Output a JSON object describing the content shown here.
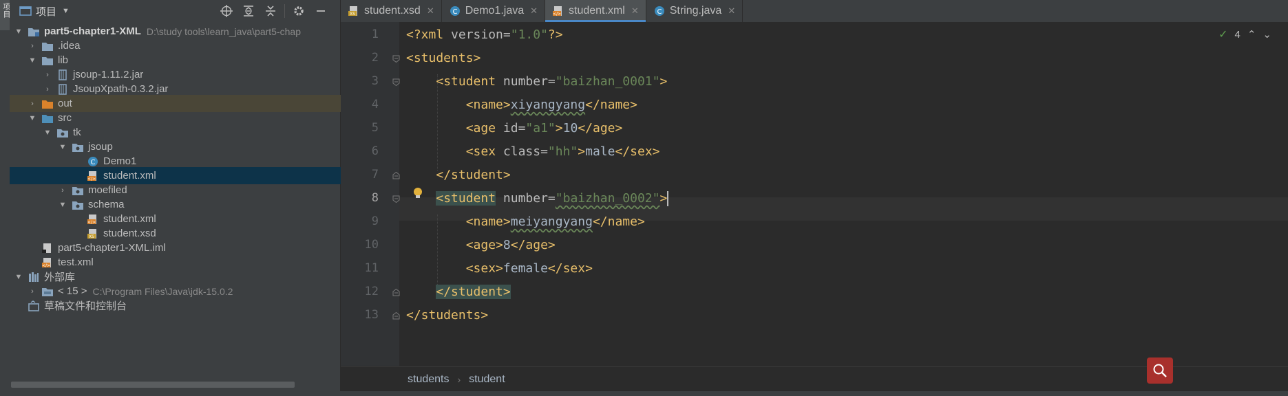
{
  "sidebar_strip": {
    "label": "项目"
  },
  "project_panel": {
    "title": "项目",
    "tree": [
      {
        "label": "part5-chapter1-XML",
        "path": "D:\\study tools\\learn_java\\part5-chap",
        "icon": "module-folder-icon",
        "depth": 0,
        "arrow": "down"
      },
      {
        "label": ".idea",
        "icon": "folder-icon",
        "depth": 1,
        "arrow": "right"
      },
      {
        "label": "lib",
        "icon": "folder-icon",
        "depth": 1,
        "arrow": "down"
      },
      {
        "label": "jsoup-1.11.2.jar",
        "icon": "jar-icon",
        "depth": 2,
        "arrow": "right"
      },
      {
        "label": "JsoupXpath-0.3.2.jar",
        "icon": "jar-icon",
        "depth": 2,
        "arrow": "right"
      },
      {
        "label": "out",
        "icon": "orange-folder-icon",
        "depth": 1,
        "arrow": "right"
      },
      {
        "label": "src",
        "icon": "source-folder-icon",
        "depth": 1,
        "arrow": "down"
      },
      {
        "label": "tk",
        "icon": "package-icon",
        "depth": 2,
        "arrow": "down"
      },
      {
        "label": "jsoup",
        "icon": "package-icon",
        "depth": 3,
        "arrow": "down"
      },
      {
        "label": "Demo1",
        "icon": "java-class-icon",
        "depth": 4,
        "arrow": ""
      },
      {
        "label": "student.xml",
        "icon": "xml-file-icon",
        "depth": 4,
        "arrow": ""
      },
      {
        "label": "moefiled",
        "icon": "package-icon",
        "depth": 3,
        "arrow": "right"
      },
      {
        "label": "schema",
        "icon": "package-icon",
        "depth": 3,
        "arrow": "down"
      },
      {
        "label": "student.xml",
        "icon": "xml-file-icon",
        "depth": 4,
        "arrow": ""
      },
      {
        "label": "student.xsd",
        "icon": "xsd-file-icon",
        "depth": 4,
        "arrow": ""
      },
      {
        "label": "part5-chapter1-XML.iml",
        "icon": "iml-file-icon",
        "depth": 1,
        "arrow": ""
      },
      {
        "label": "test.xml",
        "icon": "xml-file-icon",
        "depth": 1,
        "arrow": ""
      },
      {
        "label": "外部库",
        "icon": "library-icon",
        "depth": 0,
        "arrow": "down"
      },
      {
        "label": "< 15 >",
        "path": "C:\\Program Files\\Java\\jdk-15.0.2",
        "icon": "jdk-folder-icon",
        "depth": 1,
        "arrow": "right"
      },
      {
        "label": "草稿文件和控制台",
        "icon": "scratches-icon",
        "depth": 0,
        "arrow": ""
      }
    ]
  },
  "tabs": [
    {
      "label": "student.xsd",
      "icon": "xsd-file-icon",
      "active": false
    },
    {
      "label": "Demo1.java",
      "icon": "java-class-icon",
      "active": false
    },
    {
      "label": "student.xml",
      "icon": "xml-file-icon",
      "active": true
    },
    {
      "label": "String.java",
      "icon": "java-class-icon",
      "active": false
    }
  ],
  "editor": {
    "line_numbers": [
      "1",
      "2",
      "3",
      "4",
      "5",
      "6",
      "7",
      "8",
      "9",
      "10",
      "11",
      "12",
      "13"
    ],
    "current_line": "8",
    "inspection_count": "4",
    "code": {
      "l1": {
        "pi_open": "<?xml",
        "attr": " version=",
        "val": "\"1.0\"",
        "pi_close": "?>"
      },
      "l2": {
        "tag": "<students>"
      },
      "l3": {
        "tag_open": "<student",
        "attr": " number=",
        "val": "\"baizhan_0001\"",
        "close": ">"
      },
      "l4": {
        "open": "<name>",
        "text": "xiyangyang",
        "close": "</name>"
      },
      "l5": {
        "tag_open": "<age",
        "attr": " id=",
        "val": "\"a1\"",
        "gt": ">",
        "text": "10",
        "close": "</age>"
      },
      "l6": {
        "tag_open": "<sex",
        "attr": " class=",
        "val": "\"hh\"",
        "gt": ">",
        "text": "male",
        "close": "</sex>"
      },
      "l7": {
        "tag": "</student>"
      },
      "l8": {
        "tag_open": "<student",
        "attr": " number=",
        "val": "\"baizhan_0002\"",
        "close": ">"
      },
      "l9": {
        "open": "<name>",
        "text": "meiyangyang",
        "close": "</name>"
      },
      "l10": {
        "open": "<age>",
        "text": "8",
        "close": "</age>"
      },
      "l11": {
        "open": "<sex>",
        "text": "female",
        "close": "</sex>"
      },
      "l12": {
        "tag": "</student>"
      },
      "l13": {
        "tag": "</students>"
      }
    }
  },
  "breadcrumbs": [
    "students",
    "student"
  ],
  "colors": {
    "tag": "#e8bf6a",
    "attr_value": "#6a8759",
    "selection": "#0d3349",
    "accent": "#4a88c7",
    "search_button": "#a8302c"
  }
}
